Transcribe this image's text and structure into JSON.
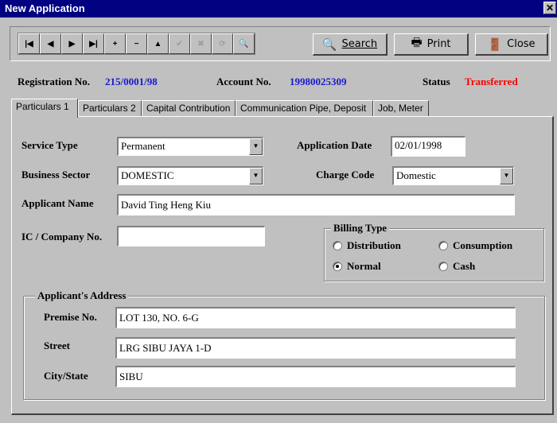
{
  "window": {
    "title": "New Application",
    "close_glyph": "✕"
  },
  "toolbar": {
    "nav_buttons": [
      {
        "name": "first-record-button",
        "glyph": "|◀"
      },
      {
        "name": "prev-record-button",
        "glyph": "◀"
      },
      {
        "name": "next-record-button",
        "glyph": "▶"
      },
      {
        "name": "last-record-button",
        "glyph": "▶|"
      },
      {
        "name": "add-record-button",
        "glyph": "+"
      },
      {
        "name": "delete-record-button",
        "glyph": "−"
      },
      {
        "name": "edit-record-button",
        "glyph": "▲"
      },
      {
        "name": "save-record-button",
        "glyph": "✔"
      },
      {
        "name": "cancel-record-button",
        "glyph": "✖"
      },
      {
        "name": "refresh-button",
        "glyph": "⟳"
      },
      {
        "name": "lookup-button",
        "glyph": "🔍"
      }
    ],
    "search_label": "Search",
    "print_label": "Print",
    "close_label": "Close"
  },
  "header": {
    "registration_label": "Registration No.",
    "registration_value": "215/0001/98",
    "account_label": "Account No.",
    "account_value": "19980025309",
    "status_label": "Status",
    "status_value": "Transferred",
    "value_color": "#1a1acc",
    "status_color": "#ff0000"
  },
  "tabs": [
    "Particulars 1",
    "Particulars 2",
    "Capital Contribution",
    "Communication Pipe, Deposit",
    "Job, Meter"
  ],
  "form": {
    "service_type_label": "Service Type",
    "service_type_value": "Permanent",
    "application_date_label": "Application Date",
    "application_date_value": "02/01/1998",
    "business_sector_label": "Business Sector",
    "business_sector_value": "DOMESTIC",
    "charge_code_label": "Charge Code",
    "charge_code_value": "Domestic",
    "applicant_name_label": "Applicant Name",
    "applicant_name_value": "David Ting Heng Kiu",
    "ic_label": "IC / Company No.",
    "ic_value": "",
    "billing": {
      "title": "Billing Type",
      "options": [
        "Distribution",
        "Consumption",
        "Normal",
        "Cash"
      ],
      "selected": "Normal"
    },
    "address": {
      "title": "Applicant's Address",
      "premise_label": "Premise No.",
      "premise_value": "LOT 130, NO. 6-G",
      "street_label": "Street",
      "street_value": "LRG SIBU JAYA 1-D",
      "city_label": "City/State",
      "city_value": "SIBU"
    }
  }
}
